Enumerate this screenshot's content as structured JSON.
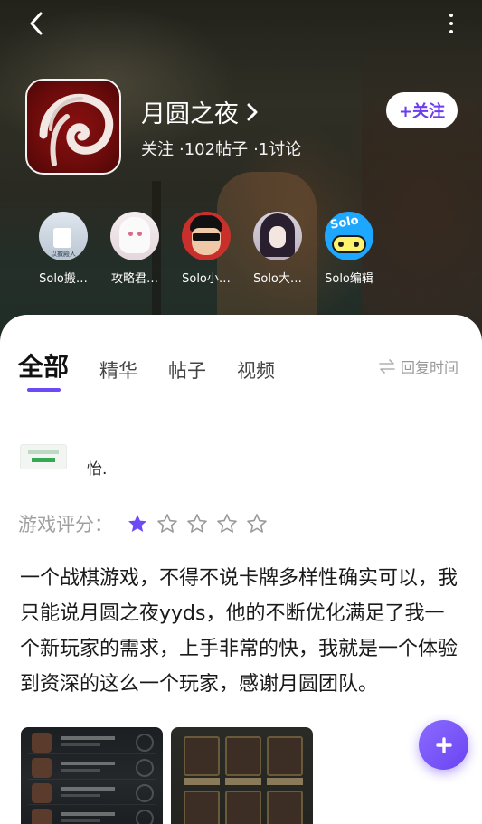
{
  "header": {
    "back_icon": "chevron-left-icon",
    "more_icon": "more-vertical-icon",
    "game_title": "月圆之夜",
    "title_chevron_icon": "chevron-right-icon",
    "stats": [
      "关注",
      "·102帖子",
      "·1讨论"
    ],
    "follow_label": "+关注",
    "colors": {
      "follow_text": "#6c3cf0"
    }
  },
  "moderators": [
    {
      "name": "Solo搬…",
      "avatar": "avatar-photo"
    },
    {
      "name": "攻略君…",
      "avatar": "avatar-anime-girl"
    },
    {
      "name": "Solo小…",
      "avatar": "avatar-cartoon-glasses"
    },
    {
      "name": "Solo大…",
      "avatar": "avatar-dark-hair"
    },
    {
      "name": "Solo编辑",
      "avatar": "avatar-solo-logo"
    }
  ],
  "solo_logo_text": "Solo",
  "avatar_photo_caption": "以撒殿人",
  "tabs": [
    {
      "label": "全部",
      "active": true
    },
    {
      "label": "精华",
      "active": false
    },
    {
      "label": "帖子",
      "active": false
    },
    {
      "label": "视频",
      "active": false
    }
  ],
  "sort": {
    "icon": "swap-icon",
    "label": "回复时间"
  },
  "post": {
    "author_name": "怡.",
    "rating_label": "游戏评分：",
    "rating": 1,
    "rating_max": 5,
    "body": "一个战棋游戏，不得不说卡牌多样性确实可以，我只能说月圆之夜yyds，他的不断优化满足了我一个新玩家的需求，上手非常的快，我就是一个体验到资深的这么一个玩家，感谢月圆团队。",
    "images": [
      "screenshot-list",
      "screenshot-cards"
    ]
  },
  "fab_icon": "plus-icon",
  "colors": {
    "accent": "#6c4af5",
    "star_filled": "#6c4af5",
    "star_empty": "#9a9a9a"
  }
}
